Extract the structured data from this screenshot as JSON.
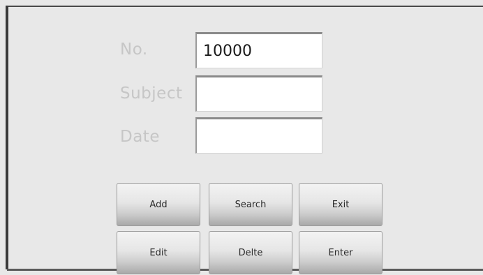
{
  "form": {
    "fields": [
      {
        "label": "No.",
        "value": "10000"
      },
      {
        "label": "Subject",
        "value": ""
      },
      {
        "label": "Date",
        "value": ""
      }
    ]
  },
  "buttons": {
    "add": "Add",
    "search": "Search",
    "exit": "Exit",
    "edit": "Edit",
    "delete": "Delte",
    "enter": "Enter"
  }
}
